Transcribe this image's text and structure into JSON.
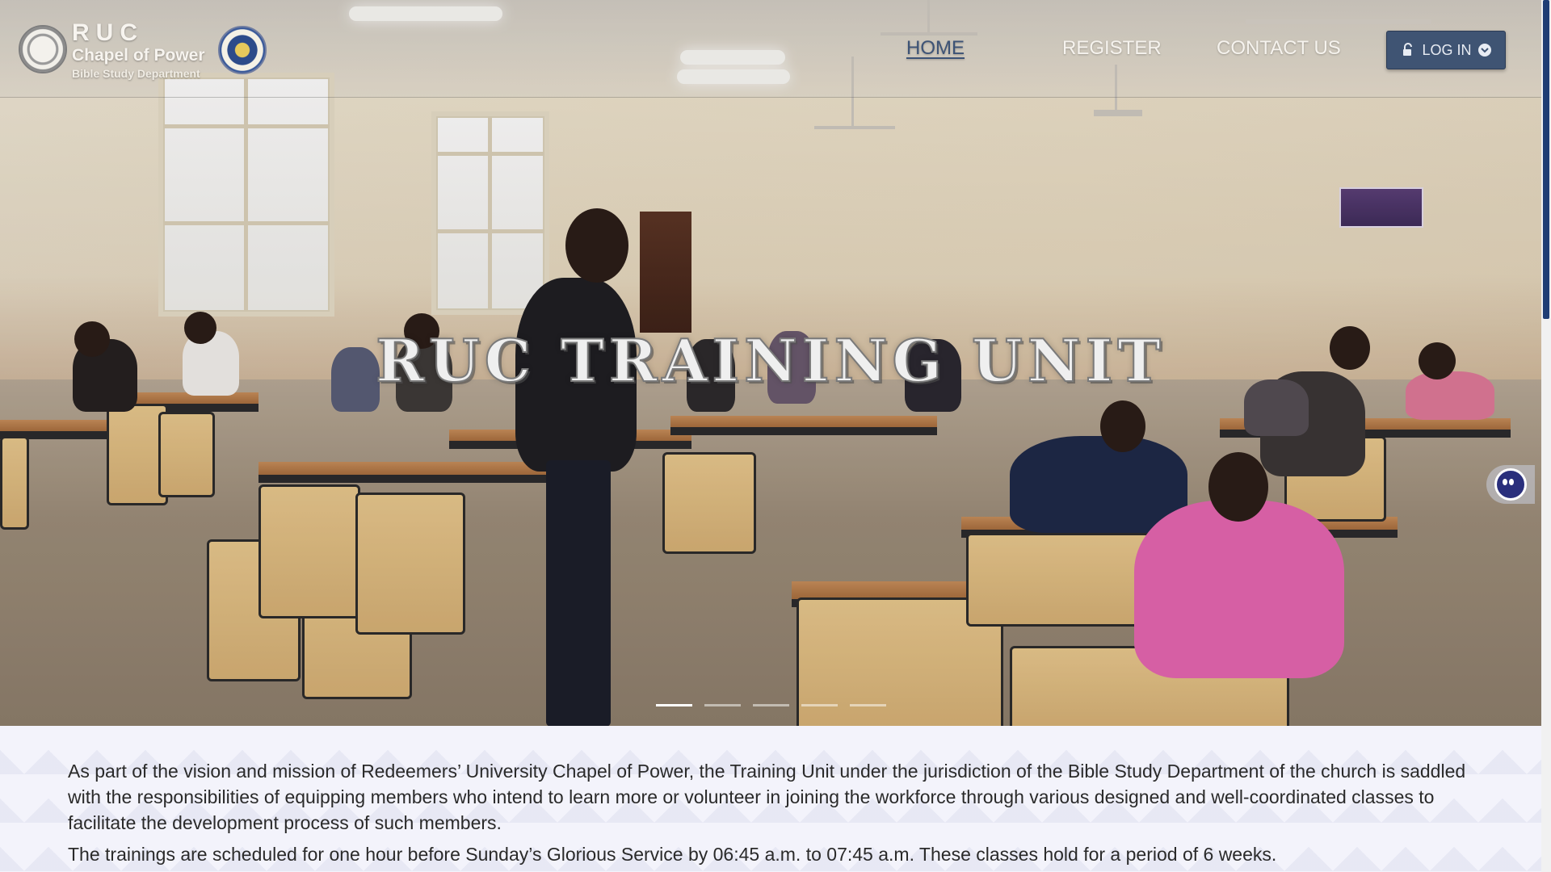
{
  "brand": {
    "short_name": "RUC",
    "name": "Chapel of Power",
    "department": "Bible Study Department"
  },
  "nav": {
    "items": [
      {
        "label": "HOME",
        "active": true
      },
      {
        "label": "REGISTER",
        "active": false
      },
      {
        "label": "CONTACT US",
        "active": false
      }
    ],
    "login_label": "LOG IN"
  },
  "hero": {
    "title": "RUC TRAINING UNIT",
    "slide_count": 5,
    "active_slide": 1
  },
  "content": {
    "paragraph1": "As part of the vision and mission of Redeemers’ University Chapel of Power, the Training Unit under the jurisdiction of the Bible Study Department of the church is saddled with the responsibilities of equipping members who intend to learn more or volunteer in joining the workforce through various designed and well-coordinated classes to facilitate the development process of such members.",
    "paragraph2": "The trainings are scheduled for one hour before Sunday’s Glorious Service by 06:45 a.m. to 07:45 a.m. These classes hold for a period of 6 weeks."
  },
  "colors": {
    "login_bg": "#3f5473",
    "active_nav": "#3d5376",
    "content_bg": "#f3f3fb",
    "scroll_thumb": "#1f3d74"
  },
  "icons": {
    "left_logo": "chapel-seal-icon",
    "right_logo": "university-crest-icon",
    "login": "lock-icon",
    "login_dropdown": "chevron-down-icon",
    "chat": "chat-bot-icon"
  }
}
